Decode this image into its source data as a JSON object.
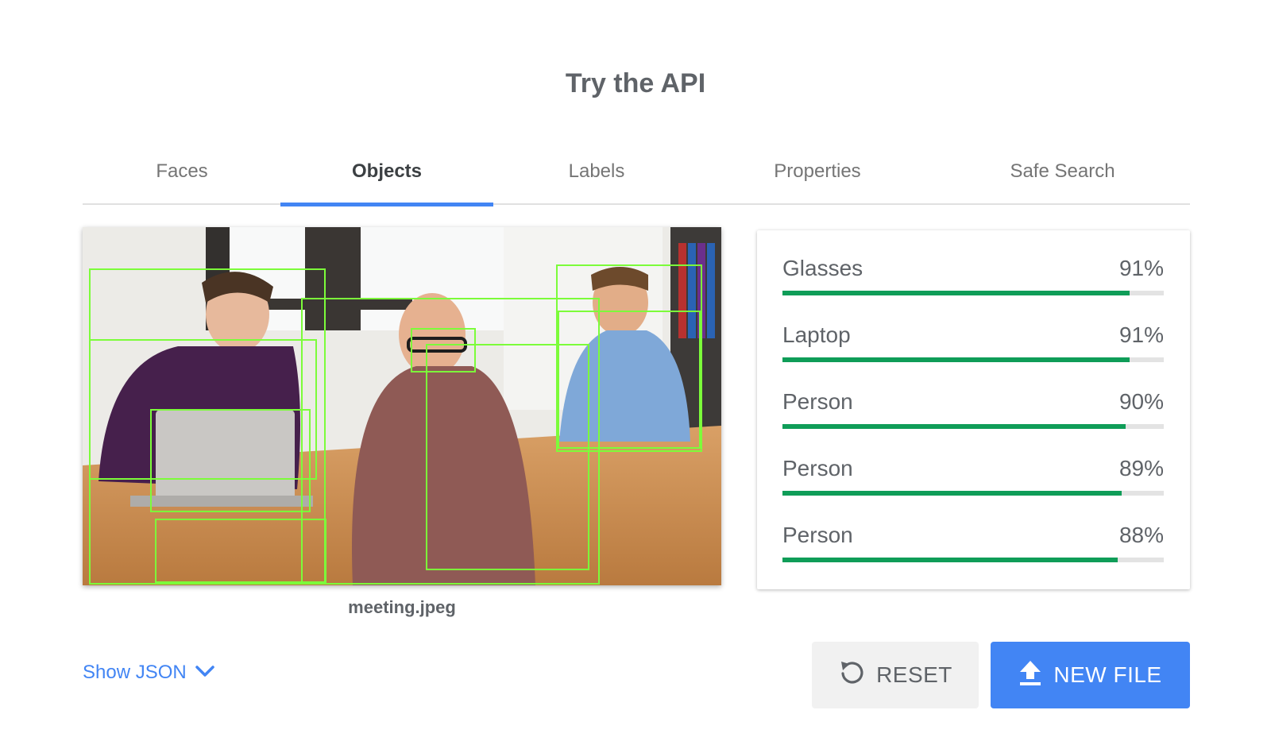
{
  "page": {
    "title": "Try the API"
  },
  "tabs": [
    {
      "label": "Faces",
      "active": false
    },
    {
      "label": "Objects",
      "active": true
    },
    {
      "label": "Labels",
      "active": false
    },
    {
      "label": "Properties",
      "active": false
    },
    {
      "label": "Safe Search",
      "active": false
    }
  ],
  "image": {
    "filename": "meeting.jpeg"
  },
  "results": [
    {
      "name": "Glasses",
      "percent": "91%",
      "score": 0.91
    },
    {
      "name": "Laptop",
      "percent": "91%",
      "score": 0.91
    },
    {
      "name": "Person",
      "percent": "90%",
      "score": 0.9
    },
    {
      "name": "Person",
      "percent": "89%",
      "score": 0.89
    },
    {
      "name": "Person",
      "percent": "88%",
      "score": 0.88
    }
  ],
  "actions": {
    "show_json": "Show JSON",
    "reset": "RESET",
    "new_file": "NEW FILE"
  },
  "colors": {
    "accent": "#4285f4",
    "bar": "#0f9d58",
    "box": "#7cfc3a"
  },
  "icons": {
    "show_json": "chevron-down-icon",
    "reset": "reset-icon",
    "new_file": "upload-icon"
  }
}
